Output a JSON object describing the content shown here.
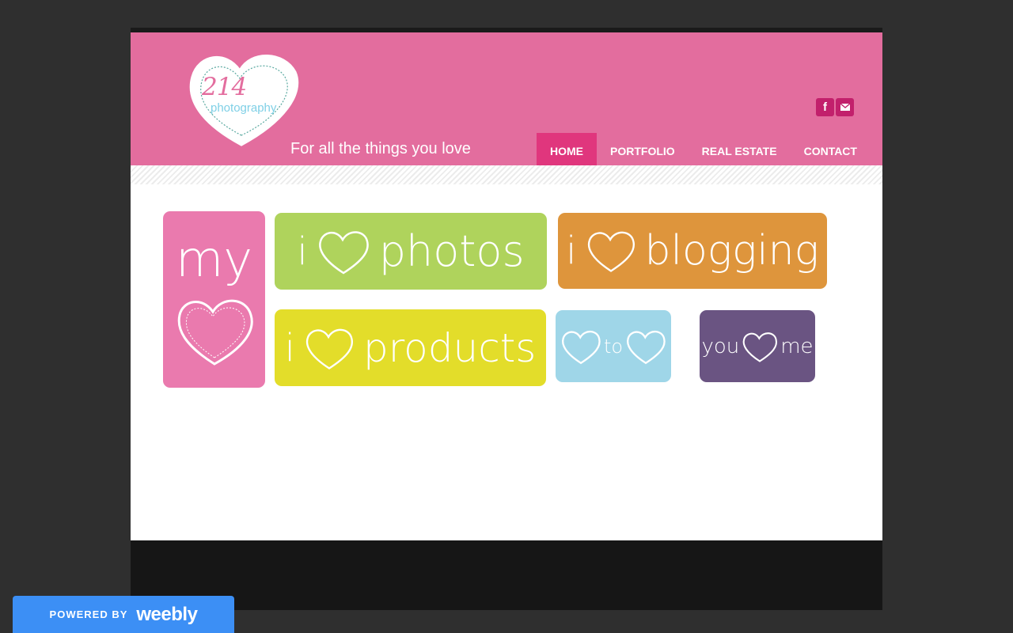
{
  "logo": {
    "number": "214",
    "word": "photography",
    "tagline": "For all the things you love"
  },
  "social": {
    "facebook_label": "f"
  },
  "nav": [
    "HOME",
    "PORTFOLIO",
    "REAL ESTATE",
    "CONTACT"
  ],
  "tiles": {
    "my": {
      "word": "my",
      "color": "#ea7aae"
    },
    "photos": {
      "prefix": "i",
      "word": "photos",
      "color": "#afd35c"
    },
    "blogging": {
      "prefix": "i",
      "word": "blogging",
      "color": "#de953c"
    },
    "products": {
      "prefix": "i",
      "word": "products",
      "color": "#e3dd2a"
    },
    "to": {
      "word": "to",
      "color": "#9fd6e8"
    },
    "you_me": {
      "left": "you",
      "right": "me",
      "color": "#6a5482"
    }
  },
  "weebly": {
    "powered_by": "POWERED BY",
    "brand": "weebly"
  },
  "colors": {
    "header": "#e36d9e",
    "nav_active": "#e0367d",
    "social": "#c2206c",
    "footer": "#161616",
    "page_bg": "#2f2f2f"
  }
}
